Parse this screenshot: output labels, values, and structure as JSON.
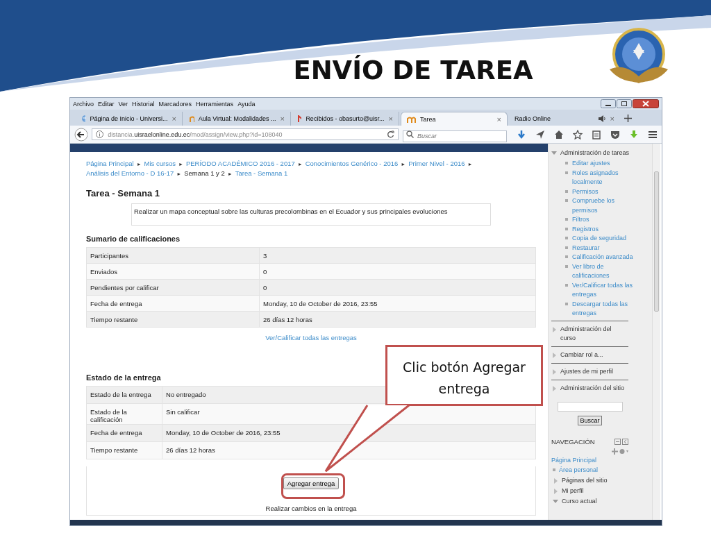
{
  "slide": {
    "title": "ENVÍO DE TAREA"
  },
  "browser": {
    "menu": [
      "Archivo",
      "Editar",
      "Ver",
      "Historial",
      "Marcadores",
      "Herramientas",
      "Ayuda"
    ],
    "tabs": [
      {
        "label": "Página de Inicio - Universi...",
        "selected": false,
        "audio": false,
        "close": "×"
      },
      {
        "label": "Aula Virtual: Modalidades ...",
        "selected": false,
        "audio": false,
        "close": "×"
      },
      {
        "label": "Recibidos - obasurto@uisr...",
        "selected": false,
        "audio": false,
        "close": "×"
      },
      {
        "label": "Tarea",
        "selected": true,
        "audio": false,
        "close": "×"
      },
      {
        "label": "Radio Online",
        "selected": false,
        "audio": true,
        "close": "×"
      }
    ],
    "url": "distancia.**uisraelonline.edu.ec**/mod/assign/view.php?id=108040",
    "search_placeholder": "Buscar"
  },
  "breadcrumb_separator": "►",
  "breadcrumb": [
    {
      "label": "Página Principal",
      "link": true
    },
    {
      "label": "Mis cursos",
      "link": true
    },
    {
      "label": "PERÍODO ACADÉMICO 2016 - 2017",
      "link": true
    },
    {
      "label": "Conocimientos Genérico - 2016",
      "link": true
    },
    {
      "label": "Primer Nivel - 2016",
      "link": true
    },
    {
      "label": "Análisis del Entorno - D 16-17",
      "link": true
    },
    {
      "label": "Semana 1 y 2",
      "link": false
    },
    {
      "label": "Tarea - Semana 1",
      "link": true
    }
  ],
  "assignment": {
    "title": "Tarea - Semana 1",
    "description": "Realizar un mapa conceptual sobre las culturas precolombinas en el Ecuador y sus  principales evoluciones"
  },
  "grading_summary": {
    "heading": "Sumario de calificaciones",
    "rows": [
      {
        "label": "Participantes",
        "value": "3"
      },
      {
        "label": "Enviados",
        "value": "0"
      },
      {
        "label": "Pendientes por calificar",
        "value": "0"
      },
      {
        "label": "Fecha de entrega",
        "value": "Monday, 10 de October de 2016, 23:55"
      },
      {
        "label": "Tiempo restante",
        "value": "26 días 12 horas"
      }
    ],
    "link": "Ver/Calificar todas las entregas"
  },
  "submission_status": {
    "heading": "Estado de la entrega",
    "rows": [
      {
        "label": "Estado de la entrega",
        "value": "No entregado"
      },
      {
        "label": "Estado de la calificación",
        "value": "Sin calificar"
      },
      {
        "label": "Fecha de entrega",
        "value": "Monday, 10 de October de 2016, 23:55"
      },
      {
        "label": "Tiempo restante",
        "value": "26 días 12 horas"
      }
    ],
    "button": "Agregar entrega",
    "note": "Realizar cambios en la entrega"
  },
  "callout": {
    "text": "Clic botón Agregar entrega"
  },
  "admin_block": {
    "items": [
      {
        "label": "Administración de tareas",
        "expanded": true,
        "children": [
          {
            "label": "Editar ajustes"
          },
          {
            "label": "Roles asignados localmente"
          },
          {
            "label": "Permisos"
          },
          {
            "label": "Compruebe los permisos"
          },
          {
            "label": "Filtros"
          },
          {
            "label": "Registros"
          },
          {
            "label": "Copia de seguridad"
          },
          {
            "label": "Restaurar"
          },
          {
            "label": "Calificación avanzada"
          },
          {
            "label": "Ver libro de calificaciones"
          },
          {
            "label": "Ver/Calificar todas las entregas"
          },
          {
            "label": "Descargar todas las entregas"
          }
        ]
      },
      {
        "label": "Administración del curso",
        "expanded": false
      },
      {
        "label": "Cambiar rol a...",
        "expanded": false
      },
      {
        "label": "Ajustes de mi perfil",
        "expanded": false
      },
      {
        "label": "Administración del sitio",
        "expanded": false
      }
    ],
    "search_button": "Buscar"
  },
  "navigation": {
    "title": "NAVEGACIÓN",
    "home": "Página Principal",
    "items": [
      {
        "label": "Área personal",
        "kind": "leaf"
      },
      {
        "label": "Páginas del sitio",
        "kind": "branch",
        "expanded": false
      },
      {
        "label": "Mi perfil",
        "kind": "branch",
        "expanded": false
      },
      {
        "label": "Curso actual",
        "kind": "branch",
        "expanded": true
      }
    ]
  }
}
